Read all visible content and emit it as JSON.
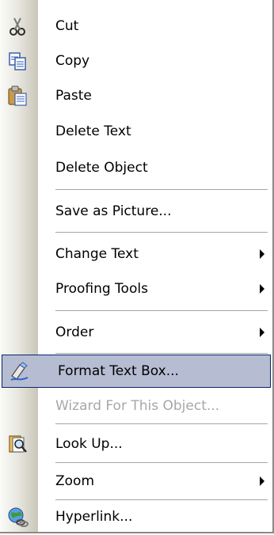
{
  "menu": {
    "items": [
      {
        "label": "Cut",
        "icon": "scissors-icon"
      },
      {
        "label": "Copy",
        "icon": "copy-icon"
      },
      {
        "label": "Paste",
        "icon": "paste-icon"
      },
      {
        "label": "Delete Text"
      },
      {
        "label": "Delete Object"
      },
      {
        "label": "Save as Picture..."
      },
      {
        "label": "Change Text",
        "submenu": true
      },
      {
        "label": "Proofing Tools",
        "submenu": true
      },
      {
        "label": "Order",
        "submenu": true
      },
      {
        "label": "Format Text Box...",
        "icon": "format-text-box-icon",
        "highlighted": true
      },
      {
        "label": "Wizard For This Object...",
        "disabled": true
      },
      {
        "label": "Look Up...",
        "icon": "look-up-icon"
      },
      {
        "label": "Zoom",
        "submenu": true
      },
      {
        "label": "Hyperlink...",
        "icon": "hyperlink-icon"
      }
    ]
  },
  "colors": {
    "highlight": "#b6bdd2",
    "highlight_border": "#0a246a",
    "disabled_text": "#a7a7a7"
  }
}
